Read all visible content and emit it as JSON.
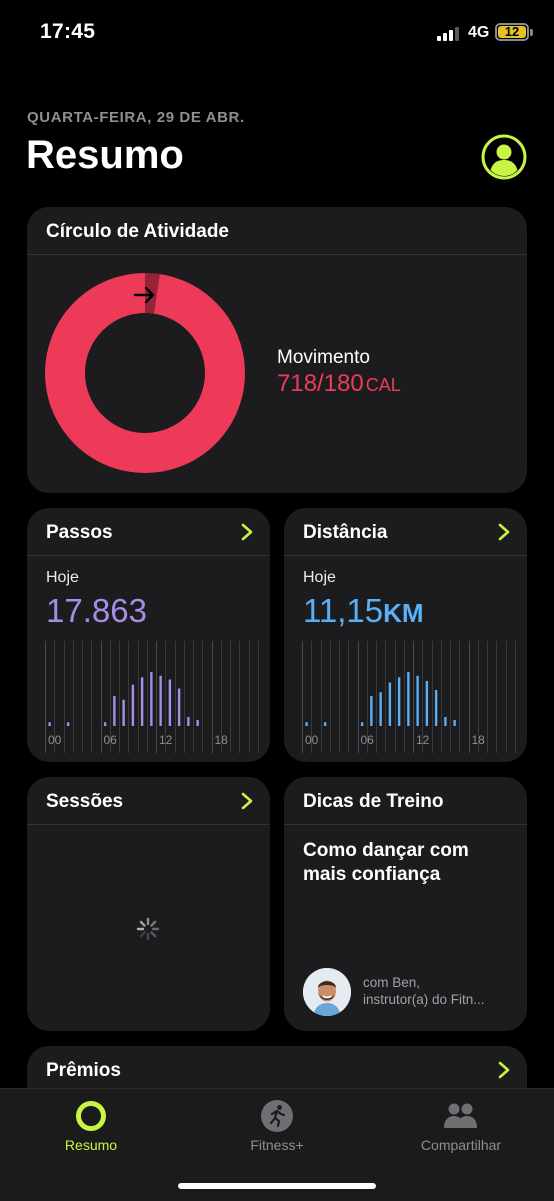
{
  "status": {
    "time": "17:45",
    "network": "4G",
    "battery": "12"
  },
  "header": {
    "date": "QUARTA-FEIRA, 29 DE ABR.",
    "title": "Resumo"
  },
  "colors": {
    "move": "#ee3a59",
    "steps": "#a48ee6",
    "distance": "#5ab0f7",
    "accent": "#c8f545",
    "card": "#1c1c1e"
  },
  "activity": {
    "title": "Círculo de Atividade",
    "move_label": "Movimento",
    "move_value": "718/180",
    "move_unit": "CAL",
    "move_progress": 3.99
  },
  "steps": {
    "title": "Passos",
    "today_label": "Hoje",
    "value": "17.863",
    "hour_ticks": [
      "00",
      "06",
      "12",
      "18"
    ],
    "hourly": [
      0.05,
      0,
      0.05,
      0,
      0,
      0,
      0.05,
      0.4,
      0.35,
      0.55,
      0.65,
      0.72,
      0.67,
      0.62,
      0.5,
      0.12,
      0.08,
      0,
      0,
      0,
      0,
      0,
      0,
      0
    ]
  },
  "distance": {
    "title": "Distância",
    "today_label": "Hoje",
    "value": "11,15",
    "unit": "KM",
    "hour_ticks": [
      "00",
      "06",
      "12",
      "18"
    ],
    "hourly": [
      0.05,
      0,
      0.05,
      0,
      0,
      0,
      0.05,
      0.4,
      0.45,
      0.58,
      0.65,
      0.72,
      0.67,
      0.6,
      0.48,
      0.12,
      0.08,
      0,
      0,
      0,
      0,
      0,
      0,
      0
    ]
  },
  "sessions": {
    "title": "Sessões"
  },
  "tips": {
    "title": "Dicas de Treino",
    "text": "Como dançar com mais confiança",
    "coach_line1": "com Ben,",
    "coach_line2": "instrutor(a) do Fitn..."
  },
  "awards": {
    "title": "Prêmios"
  },
  "tabbar": {
    "tabs": [
      {
        "label": "Resumo",
        "icon": "activity-ring-icon",
        "active": true
      },
      {
        "label": "Fitness+",
        "icon": "running-icon",
        "active": false
      },
      {
        "label": "Compartilhar",
        "icon": "people-icon",
        "active": false
      }
    ]
  }
}
